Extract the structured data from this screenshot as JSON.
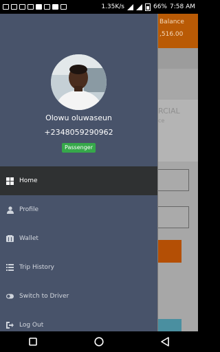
{
  "status_bar": {
    "network_speed": "1.35K/s",
    "battery": "66%",
    "time": "7:58 AM"
  },
  "background": {
    "balance_label": "Balance",
    "balance_amount": ",516.00",
    "card_title": "RCIAL",
    "card_subtitle": "ce"
  },
  "profile": {
    "name": "Olowu oluwaseun",
    "phone": "+2348059290962",
    "role": "Passenger"
  },
  "menu": {
    "items": [
      {
        "label": "Home",
        "icon": "home-grid-icon"
      },
      {
        "label": "Profile",
        "icon": "person-icon"
      },
      {
        "label": "Wallet",
        "icon": "wallet-icon"
      },
      {
        "label": "Trip History",
        "icon": "list-icon"
      },
      {
        "label": "Switch to Driver",
        "icon": "toggle-icon"
      },
      {
        "label": "Log Out",
        "icon": "logout-icon"
      }
    ]
  },
  "colors": {
    "drawer_bg": "#48536a",
    "active_item_bg": "#2f3132",
    "badge_green": "#36a84a",
    "accent_orange": "#b95a05"
  }
}
